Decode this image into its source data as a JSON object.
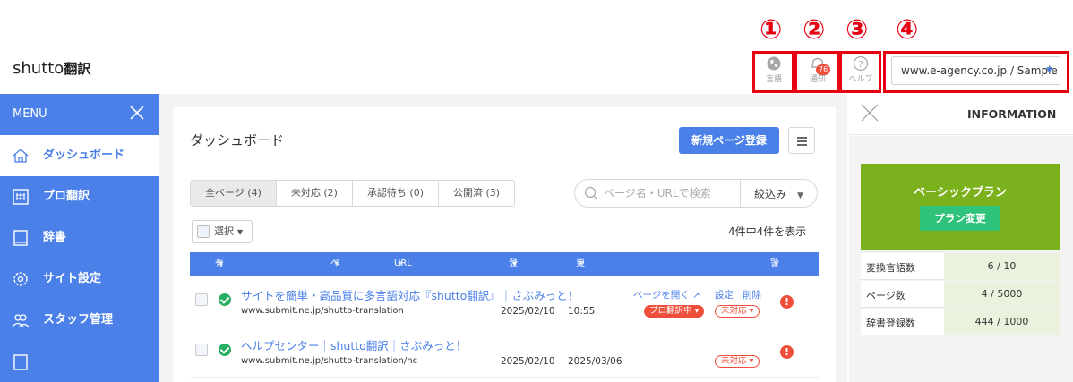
{
  "annotations": [
    "①",
    "②",
    "③",
    "④"
  ],
  "header": {
    "logo_brand": "shutto",
    "logo_suffix": "翻訳",
    "language_label": "言語",
    "notification_label": "通知",
    "notification_count": "76",
    "help_label": "ヘルプ",
    "site_selector": "www.e-agency.co.jp / Sample"
  },
  "sidebar": {
    "menu_label": "MENU",
    "items": [
      {
        "label": "ダッシュボード",
        "icon": "home-icon"
      },
      {
        "label": "プロ翻訳",
        "icon": "calendar-icon"
      },
      {
        "label": "辞書",
        "icon": "book-icon"
      },
      {
        "label": "サイト設定",
        "icon": "gear-icon"
      },
      {
        "label": "スタッフ管理",
        "icon": "users-icon"
      }
    ]
  },
  "main": {
    "title": "ダッシュボード",
    "new_page_button": "新規ページ登録",
    "tabs": [
      "全ページ (4)",
      "未対応 (2)",
      "承認待ち (0)",
      "公開済 (3)"
    ],
    "search_placeholder": "ページ名・URLで検索",
    "filter_label": "絞込み",
    "select_label": "選択",
    "count_text": "4件中4件を表示",
    "columns": {
      "enabled": "有効",
      "page_name": "ページ名",
      "url": "URL",
      "registered": "登録日",
      "updated": "更新日",
      "warning": "警告"
    },
    "rows": [
      {
        "title": "サイトを簡単・高品質に多言語対応『shutto翻訳』｜さぶみっと！",
        "url": "www.submit.ne.jp/shutto-translation",
        "registered": "2025/02/10",
        "updated": "10:55",
        "open_page": "ページを開く",
        "settings": "設定",
        "delete": "削除",
        "pro_status": "プロ翻訳中",
        "status": "未対応"
      },
      {
        "title": "ヘルプセンター｜shutto翻訳｜さぶみっと！",
        "url": "www.submit.ne.jp/shutto-translation/hc",
        "registered": "2025/02/10",
        "updated": "2025/03/06",
        "status": "未対応"
      }
    ]
  },
  "info": {
    "title": "INFORMATION",
    "plan_name": "ベーシックプラン",
    "plan_change_button": "プラン変更",
    "stats": [
      {
        "label": "変換言語数",
        "value": "6 / 10"
      },
      {
        "label": "ページ数",
        "value": "4 / 5000"
      },
      {
        "label": "辞書登録数",
        "value": "444 / 1000"
      }
    ]
  },
  "colors": {
    "primary": "#4a80e8",
    "annotation_red": "#e60012",
    "plan_green": "#7cb11e",
    "button_green": "#2fc27a",
    "alert_red": "#ef4e3a"
  }
}
